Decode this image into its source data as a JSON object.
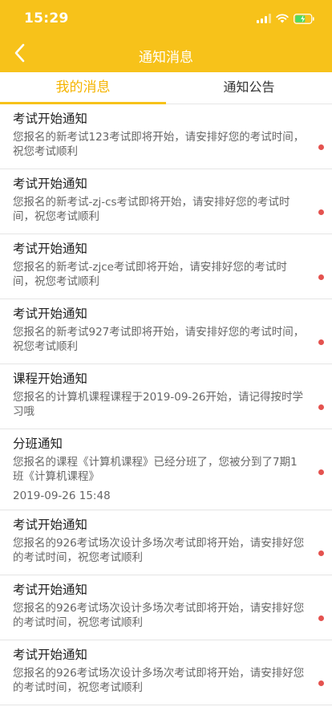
{
  "status_bar": {
    "time": "15:29"
  },
  "nav": {
    "title": "通知消息"
  },
  "tabs": [
    {
      "label": "我的消息",
      "active": true
    },
    {
      "label": "通知公告",
      "active": false
    }
  ],
  "colors": {
    "brand": "#f7c21a",
    "active_tab_text": "#f5b400",
    "unread_dot": "#e4524f",
    "battery": "#4cd964"
  },
  "messages": [
    {
      "title": "考试开始通知",
      "body": "您报名的新考试123考试即将开始，请安排好您的考试时间，祝您考试顺利",
      "date": "",
      "unread": true
    },
    {
      "title": "考试开始通知",
      "body": "您报名的新考试-zj-cs考试即将开始，请安排好您的考试时间，祝您考试顺利",
      "date": "",
      "unread": true
    },
    {
      "title": "考试开始通知",
      "body": "您报名的新考试-zjce考试即将开始，请安排好您的考试时间，祝您考试顺利",
      "date": "",
      "unread": true
    },
    {
      "title": "考试开始通知",
      "body": "您报名的新考试927考试即将开始，请安排好您的考试时间，祝您考试顺利",
      "date": "",
      "unread": true
    },
    {
      "title": "课程开始通知",
      "body": "您报名的计算机课程课程于2019-09-26开始，请记得按时学习哦",
      "date": "",
      "unread": true
    },
    {
      "title": "分班通知",
      "body": "您报名的课程《计算机课程》已经分班了，您被分到了7期1班《计算机课程》",
      "date": "2019-09-26 15:48",
      "unread": true
    },
    {
      "title": "考试开始通知",
      "body": "您报名的926考试场次设计多场次考试即将开始，请安排好您的考试时间，祝您考试顺利",
      "date": "",
      "unread": true
    },
    {
      "title": "考试开始通知",
      "body": "您报名的926考试场次设计多场次考试即将开始，请安排好您的考试时间，祝您考试顺利",
      "date": "",
      "unread": true
    },
    {
      "title": "考试开始通知",
      "body": "您报名的926考试场次设计多场次考试即将开始，请安排好您的考试时间，祝您考试顺利",
      "date": "",
      "unread": true
    }
  ]
}
